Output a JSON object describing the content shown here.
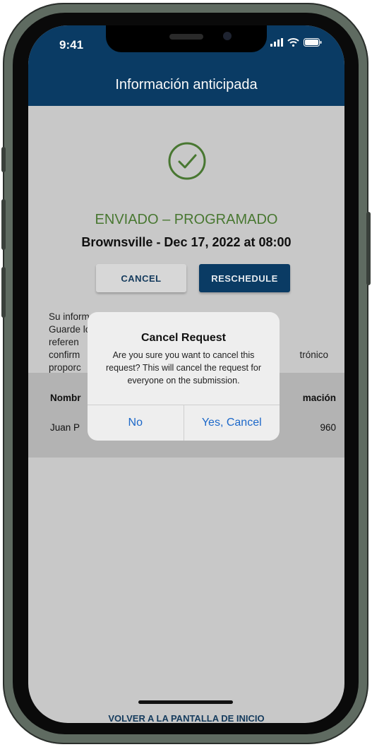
{
  "status_bar": {
    "time": "9:41",
    "icons": [
      "signal-icon",
      "wifi-icon",
      "battery-icon"
    ]
  },
  "app_bar": {
    "title": "Información anticipada"
  },
  "submission": {
    "status": "ENVIADO – PROGRAMADO",
    "location_time": "Brownsville - Dec 17, 2022 at 08:00"
  },
  "actions": {
    "cancel": "CANCEL",
    "reschedule": "RESCHEDULE"
  },
  "message": {
    "line1": "Su información ha sido enviada con éxito a CBP.",
    "line2": "Guarde los números de confirmación para su",
    "line3": "referen",
    "line4_left": "confirm",
    "line4_right": "trónico",
    "line5": "proporc"
  },
  "table": {
    "headers": {
      "name": "Nombr",
      "confirmation": "mación"
    },
    "rows": [
      {
        "name": "Juan P",
        "confirmation": "960"
      }
    ]
  },
  "footer": {
    "home_link": "VOLVER A LA PANTALLA DE INICIO"
  },
  "dialog": {
    "title": "Cancel Request",
    "message": "Are you sure you want to cancel this request? This will cancel the request for everyone on the submission.",
    "no_label": "No",
    "yes_label": "Yes, Cancel"
  },
  "colors": {
    "brand_navy": "#0b3d66",
    "success_green": "#4a7a32",
    "dialog_action_blue": "#1c68c9"
  }
}
